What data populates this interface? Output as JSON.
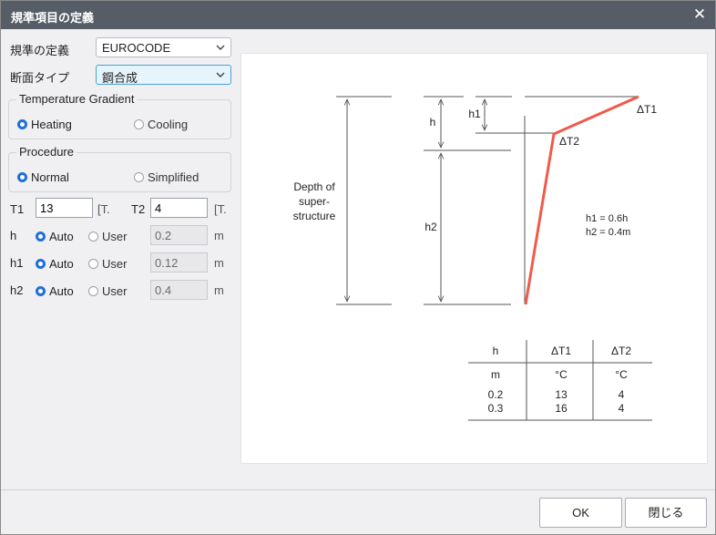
{
  "window": {
    "title": "規準項目の定義",
    "close_glyph": "✕"
  },
  "form": {
    "standard": {
      "label": "規準の定義",
      "value": "EUROCODE"
    },
    "section_type": {
      "label": "断面タイプ",
      "value": "鋼合成"
    },
    "temperature_gradient": {
      "title": "Temperature Gradient",
      "options": [
        "Heating",
        "Cooling"
      ],
      "selected": "Heating"
    },
    "procedure": {
      "title": "Procedure",
      "options": [
        "Normal",
        "Simplified"
      ],
      "selected": "Normal"
    },
    "t1": {
      "label": "T1",
      "value": "13",
      "unit": "[T."
    },
    "t2": {
      "label": "T2",
      "value": "4",
      "unit": "[T."
    },
    "rows": [
      {
        "label": "h",
        "auto": "Auto",
        "user": "User",
        "selected": "Auto",
        "value": "0.2",
        "unit": "m"
      },
      {
        "label": "h1",
        "auto": "Auto",
        "user": "User",
        "selected": "Auto",
        "value": "0.12",
        "unit": "m"
      },
      {
        "label": "h2",
        "auto": "Auto",
        "user": "User",
        "selected": "Auto",
        "value": "0.4",
        "unit": "m"
      }
    ]
  },
  "diagram": {
    "depth_label": [
      "Depth of",
      "super-",
      "structure"
    ],
    "h_label": "h",
    "h1_label": "h1",
    "h2_label": "h2",
    "dt1_label": "ΔT1",
    "dt2_label": "ΔT2",
    "formula_1": "h1 = 0.6h",
    "formula_2": "h2 = 0.4m",
    "profile_color": "#f05a4a",
    "table": {
      "headers": [
        "h",
        "ΔT1",
        "ΔT2"
      ],
      "units": [
        "m",
        "°C",
        "°C"
      ],
      "rows": [
        [
          "0.2",
          "13",
          "4"
        ],
        [
          "0.3",
          "16",
          "4"
        ]
      ]
    }
  },
  "buttons": {
    "ok": "OK",
    "close": "閉じる"
  }
}
